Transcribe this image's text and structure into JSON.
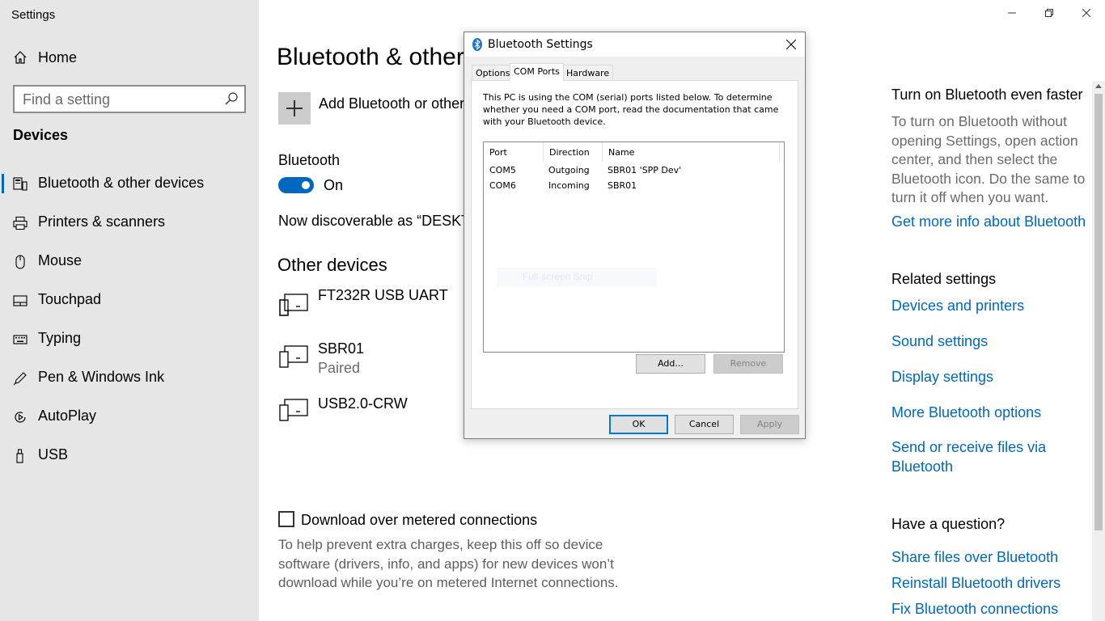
{
  "window": {
    "title": "Settings"
  },
  "sidebar": {
    "home_label": "Home",
    "search_placeholder": "Find a setting",
    "section_label": "Devices",
    "items": [
      {
        "label": "Bluetooth & other devices",
        "icon": "bluetooth-devices-icon",
        "active": true
      },
      {
        "label": "Printers & scanners",
        "icon": "printer-icon"
      },
      {
        "label": "Mouse",
        "icon": "mouse-icon"
      },
      {
        "label": "Touchpad",
        "icon": "touchpad-icon"
      },
      {
        "label": "Typing",
        "icon": "keyboard-icon"
      },
      {
        "label": "Pen & Windows Ink",
        "icon": "pen-icon"
      },
      {
        "label": "AutoPlay",
        "icon": "autoplay-icon"
      },
      {
        "label": "USB",
        "icon": "usb-icon"
      }
    ]
  },
  "main": {
    "title": "Bluetooth & other devices",
    "add_device_label": "Add Bluetooth or other device",
    "bluetooth_label": "Bluetooth",
    "bluetooth_state": "On",
    "discoverable_text": "Now discoverable as “DESKTOP",
    "other_devices_title": "Other devices",
    "devices": [
      {
        "name": "FT232R USB UART",
        "status": ""
      },
      {
        "name": "SBR01",
        "status": "Paired"
      },
      {
        "name": "USB2.0-CRW",
        "status": ""
      }
    ],
    "metered_label": "Download over metered connections",
    "metered_checked": false,
    "metered_desc": "To help prevent extra charges, keep this off so device software (drivers, info, and apps) for new devices won’t download while you’re on metered Internet connections."
  },
  "right": {
    "faster_title": "Turn on Bluetooth even faster",
    "faster_text": "To turn on Bluetooth without opening Settings, open action center, and then select the Bluetooth icon. Do the same to turn it off when you want.",
    "faster_link": "Get more info about Bluetooth",
    "related_title": "Related settings",
    "related_links": [
      "Devices and printers",
      "Sound settings",
      "Display settings",
      "More Bluetooth options",
      "Send or receive files via Bluetooth"
    ],
    "question_title": "Have a question?",
    "question_links": [
      "Share files over Bluetooth",
      "Reinstall Bluetooth drivers",
      "Fix Bluetooth connections"
    ]
  },
  "dialog": {
    "title": "Bluetooth Settings",
    "tabs": [
      "Options",
      "COM Ports",
      "Hardware"
    ],
    "selected_tab": "COM Ports",
    "description": "This PC is using the COM (serial) ports listed below. To determine whether you need a COM port, read the documentation that came with your Bluetooth device.",
    "columns": [
      "Port",
      "Direction",
      "Name"
    ],
    "rows": [
      {
        "port": "COM5",
        "direction": "Outgoing",
        "name": "SBR01 'SPP Dev'"
      },
      {
        "port": "COM6",
        "direction": "Incoming",
        "name": "SBR01"
      }
    ],
    "ghost_text": "Full-screen Snip",
    "buttons": {
      "add": "Add...",
      "remove": "Remove",
      "ok": "OK",
      "cancel": "Cancel",
      "apply": "Apply"
    }
  },
  "colors": {
    "accent": "#0067c0",
    "sidebar_bg": "#e6e6e6",
    "link": "#0067c0"
  }
}
